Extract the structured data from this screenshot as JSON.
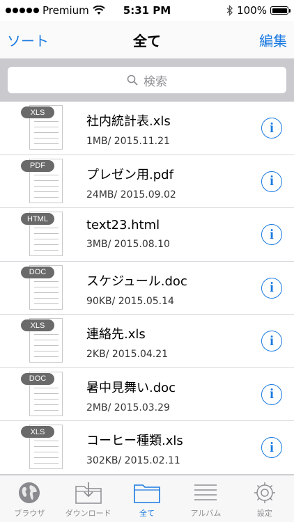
{
  "status_bar": {
    "carrier": "Premium",
    "time": "5:31 PM",
    "battery": "100%"
  },
  "nav": {
    "left_label": "ソート",
    "title": "全て",
    "right_label": "編集"
  },
  "search": {
    "placeholder": "検索"
  },
  "files": [
    {
      "type": "XLS",
      "name": "社内統計表.xls",
      "meta": "1MB/ 2015.11.21"
    },
    {
      "type": "PDF",
      "name": "プレゼン用.pdf",
      "meta": "24MB/ 2015.09.02"
    },
    {
      "type": "HTML",
      "name": "text23.html",
      "meta": "3MB/ 2015.08.10"
    },
    {
      "type": "DOC",
      "name": "スケジュール.doc",
      "meta": "90KB/ 2015.05.14"
    },
    {
      "type": "XLS",
      "name": "連絡先.xls",
      "meta": "2KB/ 2015.04.21"
    },
    {
      "type": "DOC",
      "name": "暑中見舞い.doc",
      "meta": "2MB/ 2015.03.29"
    },
    {
      "type": "XLS",
      "name": "コーヒー種類.xls",
      "meta": "302KB/ 2015.02.11"
    }
  ],
  "info_glyph": "i",
  "tabs": [
    {
      "label": "ブラウザ",
      "icon": "globe-icon"
    },
    {
      "label": "ダウンロード",
      "icon": "download-folder-icon"
    },
    {
      "label": "全て",
      "icon": "folder-icon"
    },
    {
      "label": "アルバム",
      "icon": "album-icon"
    },
    {
      "label": "設定",
      "icon": "gear-icon"
    }
  ],
  "colors": {
    "accent": "#1a7ae0",
    "badge": "#6a6a6a",
    "search_bg": "#c9c9ce"
  }
}
